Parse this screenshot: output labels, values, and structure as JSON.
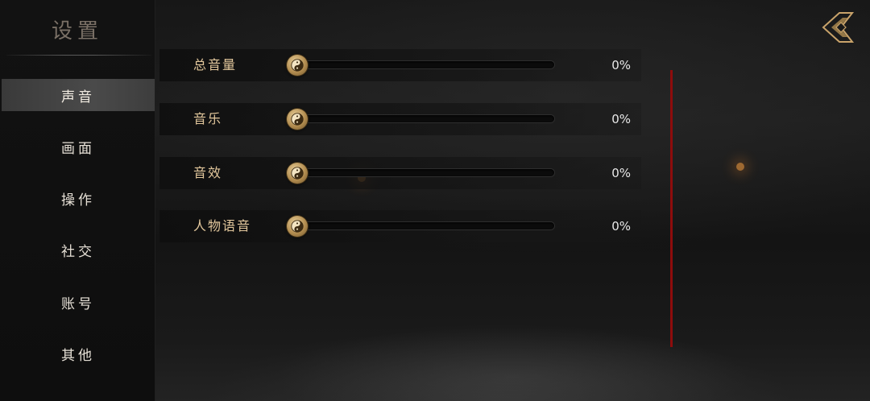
{
  "sidebar": {
    "title": "设置",
    "items": [
      {
        "label": "声音",
        "active": true
      },
      {
        "label": "画面",
        "active": false
      },
      {
        "label": "操作",
        "active": false
      },
      {
        "label": "社交",
        "active": false
      },
      {
        "label": "账号",
        "active": false
      },
      {
        "label": "其他",
        "active": false
      }
    ]
  },
  "sound": {
    "sliders": [
      {
        "label": "总音量",
        "value_text": "0%",
        "value": 0
      },
      {
        "label": "音乐",
        "value_text": "0%",
        "value": 0
      },
      {
        "label": "音效",
        "value_text": "0%",
        "value": 0
      },
      {
        "label": "人物语音",
        "value_text": "0%",
        "value": 0
      }
    ]
  },
  "icons": {
    "back": "back-arrow-icon",
    "knob": "yin-yang-icon"
  },
  "colors": {
    "accent_gold": "#c9a36a",
    "label_gold": "#e2c79c",
    "scrollbar_red": "#8e0c0c",
    "active_nav_bg": "#444444"
  }
}
